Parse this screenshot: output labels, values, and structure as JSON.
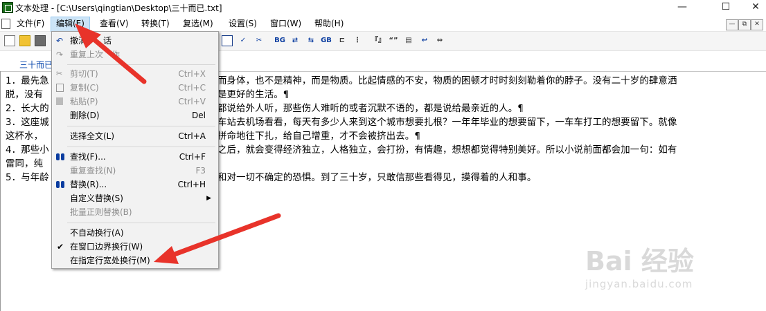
{
  "window": {
    "title": "文本处理 - [C:\\Users\\qingtian\\Desktop\\三十而已.txt]",
    "minimize": "—",
    "maximize": "☐",
    "close": "✕"
  },
  "menubar": [
    "文件(F)",
    "编辑(E)",
    "查看(V)",
    "转换(T)",
    "复选(M)",
    "设置(S)",
    "窗口(W)",
    "帮助(H)"
  ],
  "mdi": [
    "—",
    "⧉",
    "✕"
  ],
  "toolbar_icons": [
    "new-icon",
    "open-icon",
    "save-icon",
    "table-icon",
    "check-x-icon",
    "scissors-icon",
    "bg-icon",
    "convert-icon",
    "convert2-icon",
    "gb-icon",
    "line-icon",
    "dots-icon",
    "bracket-icon",
    "quote-icon",
    "doc-icon",
    "wrap-icon",
    "expand-icon"
  ],
  "tab_label": "三十而已",
  "edit_menu": {
    "undo": "撤消",
    "undo_tail": "话",
    "redo": "重复上次",
    "redo_tail": "作",
    "cut": "剪切(T)",
    "cut_sc": "Ctrl+X",
    "copy": "复制(C)",
    "copy_sc": "Ctrl+C",
    "paste": "粘贴(P)",
    "paste_sc": "Ctrl+V",
    "delete": "删除(D)",
    "delete_sc": "Del",
    "select_all": "选择全文(L)",
    "select_all_sc": "Ctrl+A",
    "find": "查找(F)...",
    "find_sc": "Ctrl+F",
    "find_again": "重复查找(N)",
    "find_again_sc": "F3",
    "replace": "替换(R)...",
    "replace_sc": "Ctrl+H",
    "custom_replace": "自定义替换(S)",
    "batch_replace": "批量正则替换(B)",
    "no_wrap": "不自动换行(A)",
    "wrap_window": "在窗口边界换行(W)",
    "wrap_width": "在指定行宽处换行(M)"
  },
  "editor_lines": [
    "1．最先急",
    "而身体，也不是精神，而是物质。比起情感的不安，物质的困顿才时时刻刻勒着你的脖子。没有二十岁的肆意洒",
    "脱，没有",
    "是更好的生活。¶",
    "2．长大的",
    "都说给外人听，那些伤人难听的或者沉默不语的，都是说给最亲近的人。¶",
    "3．这座城",
    "车站去机场看看，每天有多少人来到这个城市想要扎根？一年年毕业的想要留下，一车车打工的想要留下。就像",
    "这杯水，",
    "拼命地往下扎，给自己增重，才不会被挤出去。¶",
    "4．那些小",
    "之后，就会变得经济独立，人格独立，会打扮，有情趣，想想都觉得特别美好。所以小说前面都会加一句：如有",
    "雷同，纯",
    "5．与年龄",
    "和对一切不确定的恐惧。到了三十岁，只敢信那些看得见，摸得着的人和事。"
  ],
  "watermark": {
    "main": "Bai 经验",
    "sub": "jingyan.baidu.com"
  }
}
